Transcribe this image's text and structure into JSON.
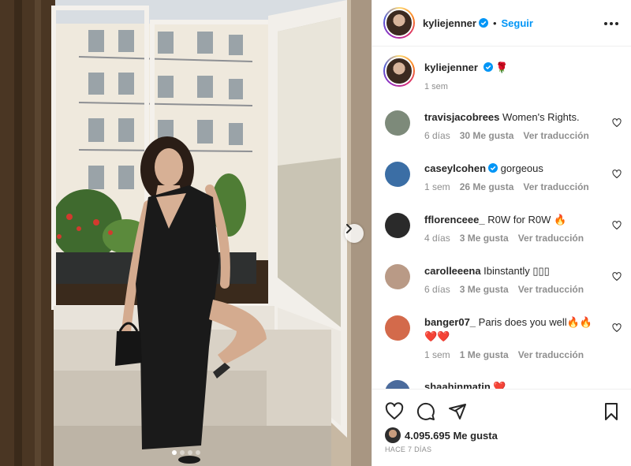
{
  "post": {
    "image_alt": "",
    "carousel": {
      "count": 4,
      "active_index": 0
    }
  },
  "header": {
    "username": "kyliejenner",
    "verified": true,
    "separator": "•",
    "follow_label": "Seguir"
  },
  "caption": {
    "username": "kyliejenner",
    "emoji": "🌹",
    "time": "1 sem"
  },
  "comments": [
    {
      "username": "travisjacobrees",
      "text": "Women's Rights.",
      "time": "6 días",
      "likes": "30 Me gusta",
      "translate": "Ver traducción",
      "verified": false,
      "avatar_color": "#7d8a7a"
    },
    {
      "username": "caseylcohen",
      "text": "gorgeous",
      "time": "1 sem",
      "likes": "26 Me gusta",
      "translate": "Ver traducción",
      "verified": true,
      "avatar_color": "#3b6ea5"
    },
    {
      "username": "fflorenceee_",
      "text": "R0W for R0W 🔥",
      "time": "4 días",
      "likes": "3 Me gusta",
      "translate": "Ver traducción",
      "verified": false,
      "avatar_color": "#2a2a2a"
    },
    {
      "username": "carolleeena",
      "text": "Ibinstantly ▯▯▯",
      "time": "6 días",
      "likes": "3 Me gusta",
      "translate": "Ver traducción",
      "verified": false,
      "avatar_color": "#b99a86"
    },
    {
      "username": "banger07_",
      "text": "Paris does you well🔥🔥 ❤️❤️",
      "time": "1 sem",
      "likes": "1 Me gusta",
      "translate": "Ver traducción",
      "verified": false,
      "avatar_color": "#d36a4b"
    },
    {
      "username": "shaahinmatin",
      "text": "❤️",
      "time": "",
      "likes": "",
      "translate": "",
      "verified": false,
      "avatar_color": "#4b6b9c"
    }
  ],
  "footer": {
    "likes_count": "4.095.695",
    "likes_label": "Me gusta",
    "ago": "HACE 7 DÍAS"
  },
  "colors": {
    "accent": "#0095f6",
    "text": "#262626",
    "muted": "#8e8e8e",
    "border": "#efefef"
  },
  "icons": [
    "verified-badge-icon",
    "more-options-icon",
    "heart-icon",
    "comment-icon",
    "share-icon",
    "bookmark-icon",
    "chevron-right-icon"
  ]
}
